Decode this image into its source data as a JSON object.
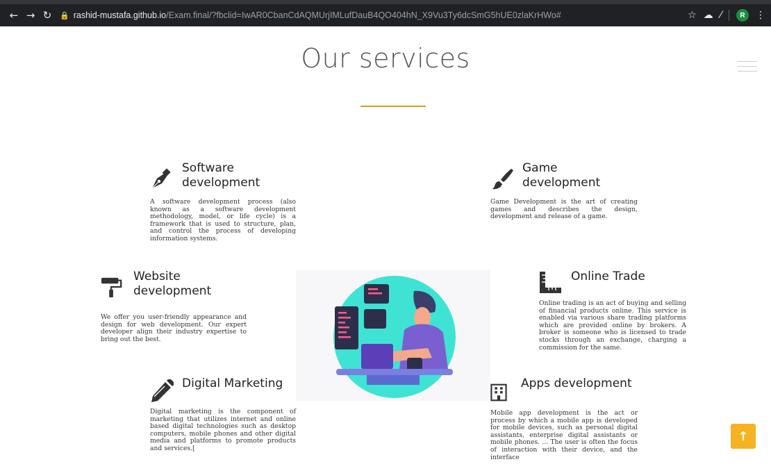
{
  "browser": {
    "url_host": "rashid-mustafa.github.io",
    "url_path": "/Exam.final/?fbclid=IwAR0CbanCdAQMUrjIMLufDauB4QO404hN_X9Vu3Ty6dcSmG5hUE0zlaKrHWo#",
    "profile_initial": "R"
  },
  "page": {
    "title": "Our services"
  },
  "services": [
    {
      "title_line1": "Software",
      "title_line2": "development",
      "icon": "pen-nib-icon",
      "description": "A software development process (also known as a software development methodology, model, or life cycle) is a framework that is used to structure, plan, and control the process of developing information systems."
    },
    {
      "title_line1": "Game",
      "title_line2": "development",
      "icon": "paint-brush-icon",
      "description": "Game Development is the art of creating games and describes the design, development and release of a game."
    },
    {
      "title_line1": "Website",
      "title_line2": "development",
      "icon": "paint-roller-icon",
      "description": "We offer you user-friendly appearance and design for web development. Our expert developer align their industry expertise to bring out the best."
    },
    {
      "title_line1": "Online Trade",
      "title_line2": "",
      "icon": "ruler-combined-icon",
      "description": "Online trading is an act of buying and selling of financial products online. This service is enabled via various share trading platforms which are provided online by brokers. A broker is someone who is licensed to trade stocks through an exchange, charging a commission for the same."
    },
    {
      "title_line1": "Digital Marketing",
      "title_line2": "",
      "icon": "pencil-icon",
      "description": "Digital marketing is the component of marketing that utilizes internet and online based digital technologies such as desktop computers, mobile phones and other digital media and platforms to promote products and services.["
    },
    {
      "title_line1": "Apps development",
      "title_line2": "",
      "icon": "building-icon",
      "description": "Mobile app development is the act or process by which a mobile app is developed for mobile devices, such as personal digital assistants, enterprise digital assistants or mobile phones. ... The user is often the focus of interaction with their device, and the interface"
    }
  ],
  "colors": {
    "accent": "#d4a017",
    "back_to_top": "#f5b323"
  }
}
